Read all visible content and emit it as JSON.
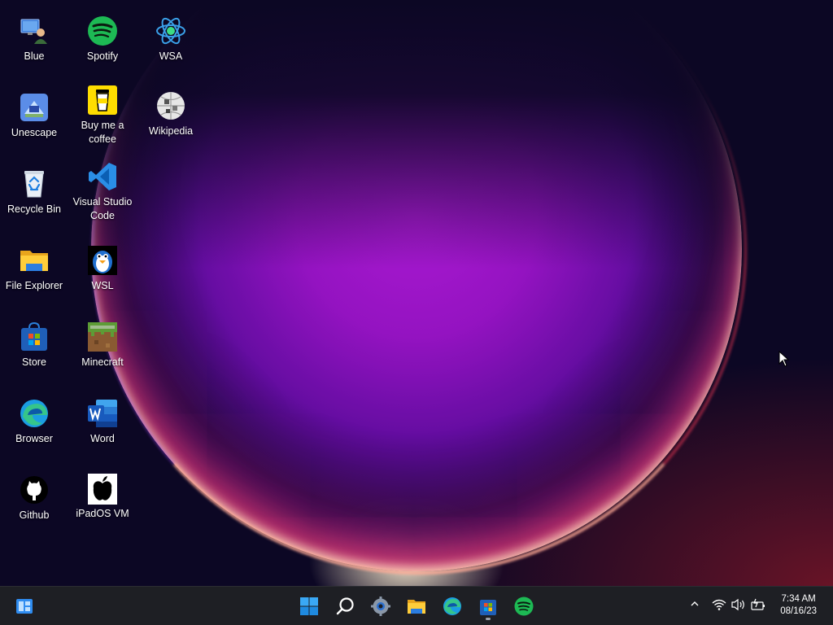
{
  "desktop": {
    "icons": [
      {
        "label": "Blue"
      },
      {
        "label": "Unescape"
      },
      {
        "label": "Recycle Bin"
      },
      {
        "label": "File Explorer"
      },
      {
        "label": "Store"
      },
      {
        "label": "Browser"
      },
      {
        "label": "Github"
      },
      {
        "label": "Spotify"
      },
      {
        "label": "Buy me a coffee"
      },
      {
        "label": "Visual Studio Code"
      },
      {
        "label": "WSL"
      },
      {
        "label": "Minecraft"
      },
      {
        "label": "Word"
      },
      {
        "label": "iPadOS VM"
      },
      {
        "label": "WSA"
      },
      {
        "label": "Wikipedia"
      }
    ]
  },
  "taskbar": {
    "left": [
      {
        "icon": "widgets-icon"
      }
    ],
    "center": [
      {
        "icon": "windows-start-icon"
      },
      {
        "icon": "search-icon"
      },
      {
        "icon": "settings-gear-icon"
      },
      {
        "icon": "file-explorer-icon"
      },
      {
        "icon": "edge-browser-icon"
      },
      {
        "icon": "store-icon"
      },
      {
        "icon": "spotify-icon"
      }
    ],
    "tray": {
      "icons": [
        "chevron-up-icon",
        "wifi-icon",
        "volume-icon",
        "battery-icon"
      ],
      "time": "7:34 AM",
      "date": "08/16/23"
    }
  },
  "colors": {
    "taskbar_bg": "#1e1f24",
    "desktop_bg": "#0c0724",
    "accent_blue": "#2f8cf0",
    "spotify_green": "#1db954"
  }
}
